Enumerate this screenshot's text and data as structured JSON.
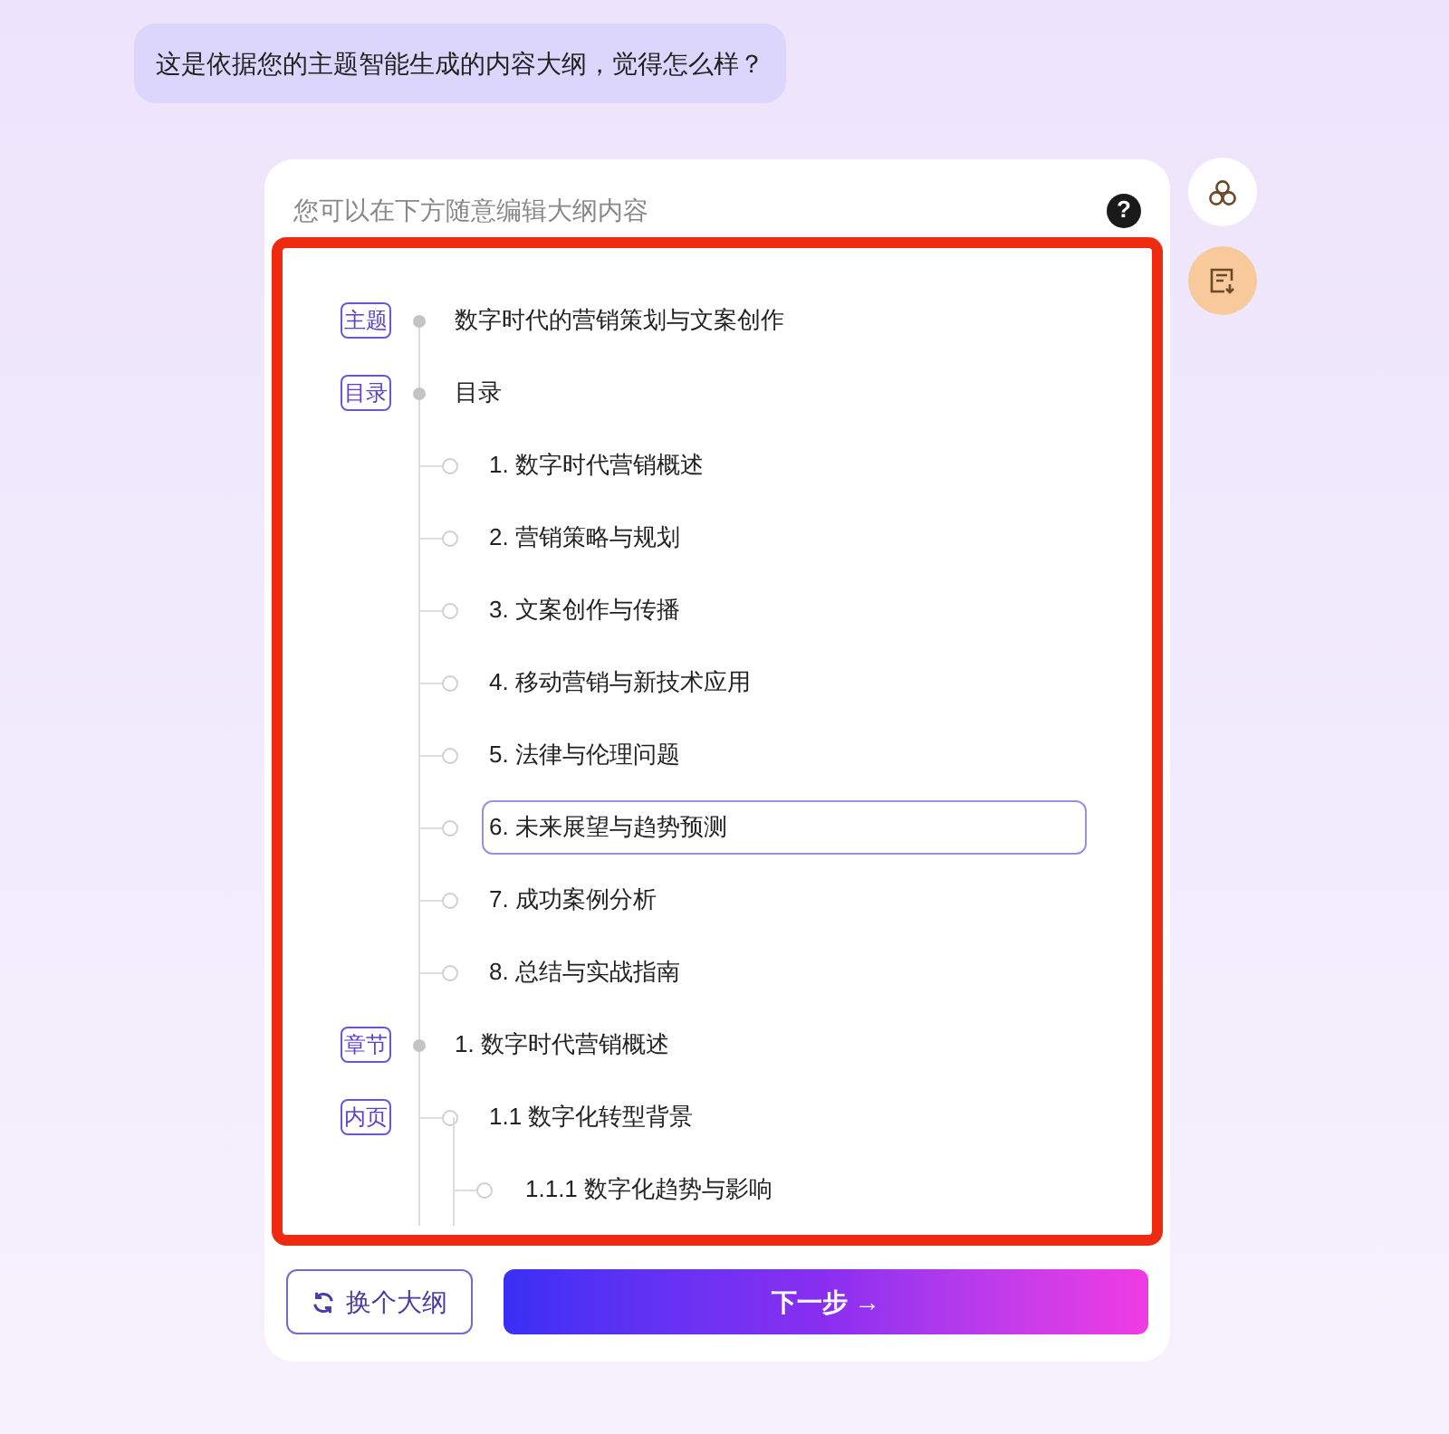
{
  "message": "这是依据您的主题智能生成的内容大纲，觉得怎么样？",
  "card": {
    "hint": "您可以在下方随意编辑大纲内容",
    "help": "?"
  },
  "outline": [
    {
      "tag": "主题",
      "text": "数字时代的营销策划与文案创作"
    },
    {
      "tag": "目录",
      "text": "目录",
      "children": [
        {
          "text": "1. 数字时代营销概述",
          "editing": false
        },
        {
          "text": "2. 营销策略与规划",
          "editing": false
        },
        {
          "text": "3. 文案创作与传播",
          "editing": false
        },
        {
          "text": "4. 移动营销与新技术应用",
          "editing": false
        },
        {
          "text": "5. 法律与伦理问题",
          "editing": false
        },
        {
          "text": "6. 未来展望与趋势预测",
          "editing": true
        },
        {
          "text": "7. 成功案例分析",
          "editing": false
        },
        {
          "text": "8. 总结与实战指南",
          "editing": false
        }
      ]
    },
    {
      "tag": "章节",
      "text": "1. 数字时代营销概述",
      "children": [
        {
          "tag": "内页",
          "text": "1.1 数字化转型背景",
          "editing": false,
          "children": [
            {
              "text": "1.1.1 数字化趋势与影响"
            }
          ]
        }
      ]
    }
  ],
  "buttons": {
    "change": "换个大纲",
    "next": "下一步 →"
  }
}
